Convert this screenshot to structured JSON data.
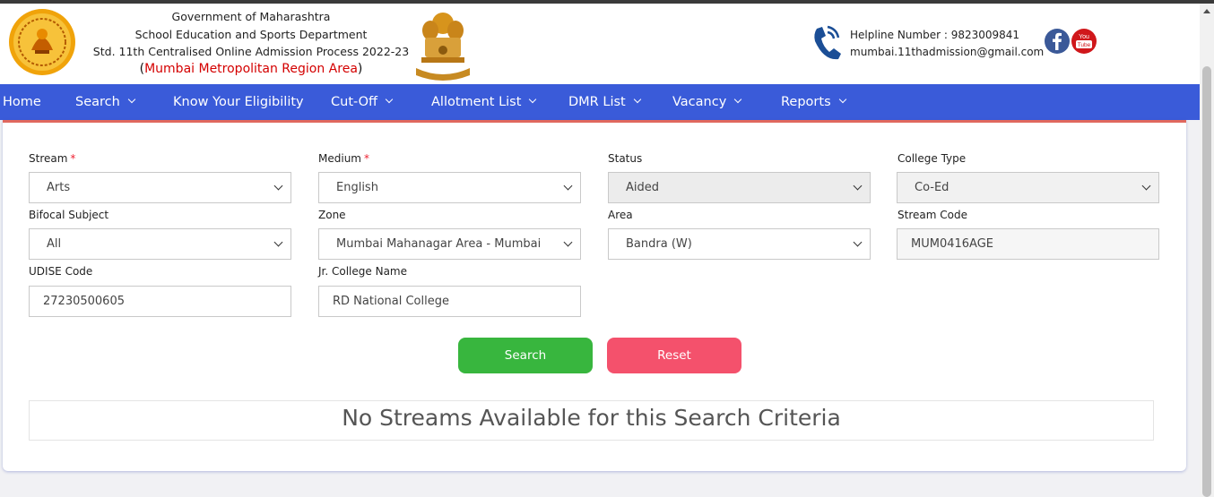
{
  "header": {
    "line1": "Government of Maharashtra",
    "line2": "School Education and Sports Department",
    "line3": "Std. 11th Centralised Online Admission Process 2022-23",
    "region_open": "(",
    "region_name": "Mumbai Metropolitan Region Area",
    "region_close": ")",
    "helpline": "Helpline Number : 9823009841",
    "email": "mumbai.11thadmission@gmail.com",
    "icons": {
      "phone": "phone-icon",
      "facebook": "facebook-icon",
      "youtube": "youtube-icon",
      "emblem": "national-emblem-icon",
      "logo": "maharashtra-seal-icon"
    },
    "youtube_label": "You Tube"
  },
  "nav": {
    "items": [
      {
        "label": "Home",
        "dropdown": false
      },
      {
        "label": "Search",
        "dropdown": true
      },
      {
        "label": "Know Your Eligibility",
        "dropdown": false
      },
      {
        "label": "Cut-Off",
        "dropdown": true
      },
      {
        "label": "Allotment List",
        "dropdown": true
      },
      {
        "label": "DMR List",
        "dropdown": true
      },
      {
        "label": "Vacancy",
        "dropdown": true
      },
      {
        "label": "Reports",
        "dropdown": true
      }
    ]
  },
  "form": {
    "stream": {
      "label": "Stream",
      "required": "*",
      "value": "Arts"
    },
    "medium": {
      "label": "Medium",
      "required": "*",
      "value": "English"
    },
    "status": {
      "label": "Status",
      "value": "Aided"
    },
    "college_type": {
      "label": "College Type",
      "value": "Co-Ed"
    },
    "bifocal": {
      "label": "Bifocal Subject",
      "value": "All"
    },
    "zone": {
      "label": "Zone",
      "value": "Mumbai Mahanagar Area - Mumbai"
    },
    "area": {
      "label": "Area",
      "value": "Bandra (W)"
    },
    "stream_code": {
      "label": "Stream Code",
      "value": "MUM0416AGE"
    },
    "udise": {
      "label": "UDISE Code",
      "value": "27230500605"
    },
    "college_name": {
      "label": "Jr. College Name",
      "value": "RD National College"
    },
    "search_label": "Search",
    "reset_label": "Reset"
  },
  "result": {
    "message": "No Streams Available for this Search Criteria"
  },
  "colors": {
    "nav": "#3a5bd9",
    "search": "#38b63e",
    "reset": "#f4516c",
    "accent_red": "#d40000"
  }
}
